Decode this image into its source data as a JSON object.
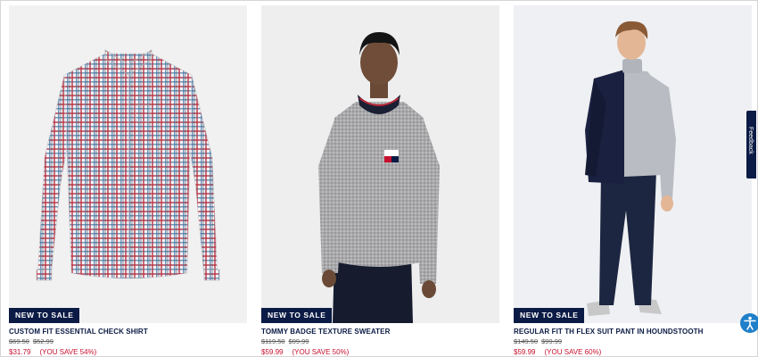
{
  "products": [
    {
      "badge": "NEW TO SALE",
      "name": "CUSTOM FIT ESSENTIAL CHECK SHIRT",
      "original_price_1": "$69.50",
      "original_price_2": "$52.99",
      "sale_price": "$31.79",
      "savings": "(YOU SAVE 54%)"
    },
    {
      "badge": "NEW TO SALE",
      "name": "TOMMY BADGE TEXTURE SWEATER",
      "original_price_1": "$119.50",
      "original_price_2": "$99.99",
      "sale_price": "$59.99",
      "savings": "(YOU SAVE 50%)"
    },
    {
      "badge": "NEW TO SALE",
      "name": "REGULAR FIT TH FLEX SUIT PANT IN HOUNDSTOOTH",
      "original_price_1": "$149.50",
      "original_price_2": "$99.99",
      "sale_price": "$59.99",
      "savings": "(YOU SAVE 60%)"
    }
  ],
  "feedback": {
    "label": "Feedback"
  },
  "colors": {
    "navy": "#0b1b45",
    "sale_red": "#c8102e",
    "accessibility_blue": "#1f7fc9"
  },
  "icons": {
    "accessibility": "accessibility-icon"
  }
}
